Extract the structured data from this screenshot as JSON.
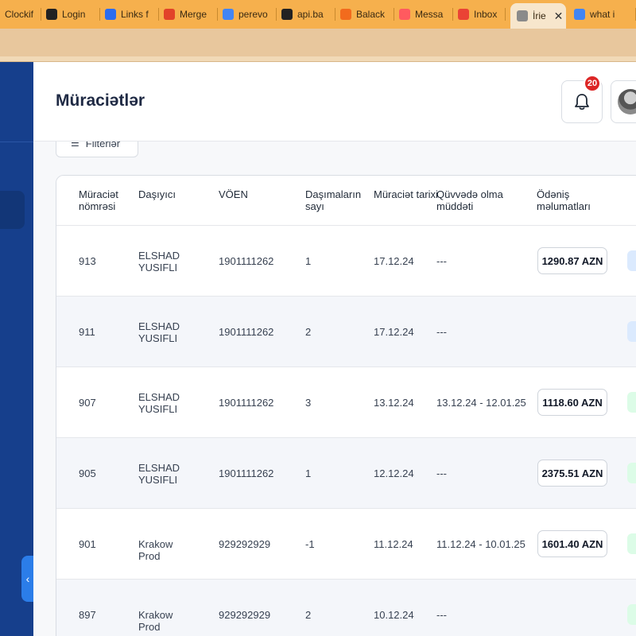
{
  "browser": {
    "tabs": [
      {
        "label": "Clockif",
        "icon": "clockify-icon",
        "color": "#2b7de9"
      },
      {
        "label": "Login",
        "icon": "openai-icon",
        "color": "#222222"
      },
      {
        "label": "Links f",
        "icon": "docs-icon",
        "color": "#2b6cf0"
      },
      {
        "label": "Merge",
        "icon": "gitlab-icon",
        "color": "#e24329"
      },
      {
        "label": "perevo",
        "icon": "google-icon",
        "color": "#4285f4"
      },
      {
        "label": "api.ba",
        "icon": "github-icon",
        "color": "#222222"
      },
      {
        "label": "Balack",
        "icon": "ball-icon",
        "color": "#f26b1d"
      },
      {
        "label": "Messa",
        "icon": "airbnb-icon",
        "color": "#ff5a5f"
      },
      {
        "label": "Inbox",
        "icon": "gmail-icon",
        "color": "#ea4335"
      },
      {
        "label": "İrie",
        "icon": "globe-icon",
        "color": "#8a8a8a",
        "active": true
      },
      {
        "label": "what i",
        "icon": "google-icon",
        "color": "#4285f4"
      }
    ],
    "close_glyph": "✕"
  },
  "header": {
    "title": "Müraciətlər",
    "notifications_count": "20"
  },
  "filter_label": "Filterlər",
  "table": {
    "columns": [
      "Müraciət nömrəsi",
      "Daşıyıcı",
      "VÖEN",
      "Daşımaların sayı",
      "Müraciət tarixi",
      "Qüvvədə olma müddəti",
      "Ödəniş məlumatları"
    ],
    "rows": [
      {
        "number": "913",
        "carrier": "ELSHAD YUSIFLI",
        "voen": "1901111262",
        "count": "1",
        "date": "17.12.24",
        "validity": "---",
        "payment": "1290.87 AZN",
        "status_color": "#dbeafe"
      },
      {
        "number": "911",
        "carrier": "ELSHAD YUSIFLI",
        "voen": "1901111262",
        "count": "2",
        "date": "17.12.24",
        "validity": "---",
        "payment": "",
        "status_color": "#dbeafe"
      },
      {
        "number": "907",
        "carrier": "ELSHAD YUSIFLI",
        "voen": "1901111262",
        "count": "3",
        "date": "13.12.24",
        "validity": "13.12.24 - 12.01.25",
        "payment": "1118.60 AZN",
        "status_color": "#dcfce7"
      },
      {
        "number": "905",
        "carrier": "ELSHAD YUSIFLI",
        "voen": "1901111262",
        "count": "1",
        "date": "12.12.24",
        "validity": "---",
        "payment": "2375.51 AZN",
        "status_color": "#dcfce7"
      },
      {
        "number": "901",
        "carrier": "Krakow Prod",
        "voen": "929292929",
        "count": "-1",
        "date": "11.12.24",
        "validity": "11.12.24 - 10.01.25",
        "payment": "1601.40 AZN",
        "status_color": "#dcfce7"
      },
      {
        "number": "897",
        "carrier": "Krakow Prod",
        "voen": "929292929",
        "count": "2",
        "date": "10.12.24",
        "validity": "---",
        "payment": "",
        "status_color": "#dcfce7"
      }
    ]
  }
}
